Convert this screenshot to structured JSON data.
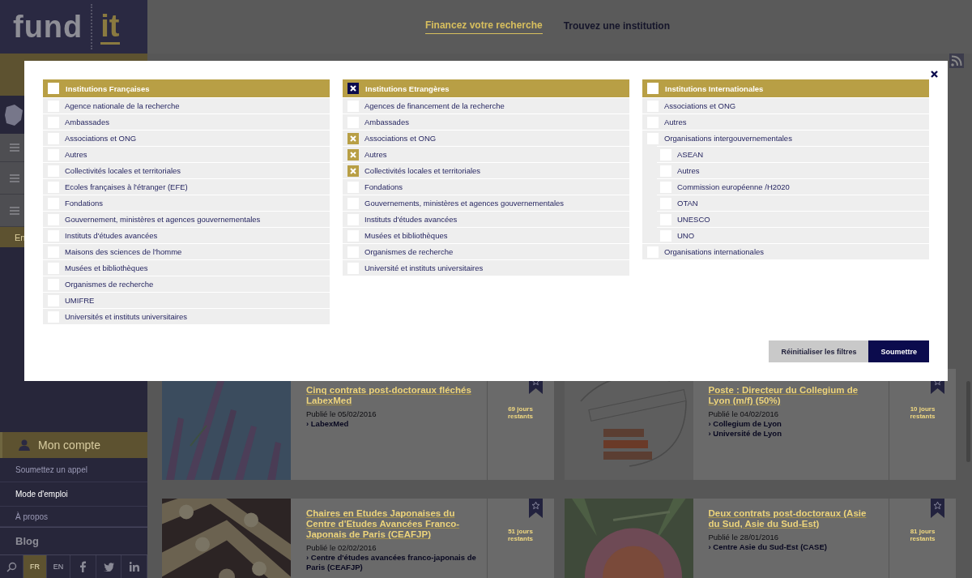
{
  "logo": {
    "word": "fund",
    "accent": "it"
  },
  "nav": [
    {
      "label": "Financez votre recherche",
      "selected": true
    },
    {
      "label": "Trouvez une institution",
      "selected": false
    }
  ],
  "sidebar": {
    "band_label": "En",
    "account": "Mon compte",
    "links": [
      {
        "label": "Soumettez un appel",
        "active": false
      },
      {
        "label": "Mode d'emploi",
        "active": true
      },
      {
        "label": "À propos",
        "active": false
      }
    ],
    "blog": "Blog",
    "languages": [
      {
        "label": "FR",
        "selected": true
      },
      {
        "label": "EN",
        "selected": false
      }
    ]
  },
  "cards": [
    {
      "kind": "lavender",
      "title": "Cinq contrats post-doctoraux fléchés LabexMed",
      "published": "Publié le 05/02/2016",
      "institutions": [
        "› LabexMed"
      ],
      "remaining": "69 jours restants"
    },
    {
      "kind": "logo",
      "title": "Poste : Directeur du Collegium de Lyon (m/f) (50%)",
      "published": "Publié le 04/02/2016",
      "institutions": [
        "› Collegium de Lyon",
        "› Université de Lyon"
      ],
      "remaining": "10 jours restants"
    },
    {
      "kind": "lanterns",
      "title": "Chaires en Etudes Japonaises du Centre d'Etudes Avancées Franco-Japonais de Paris (CEAFJP)",
      "published": "Publié le 02/02/2016",
      "institutions": [
        "› Centre d'études avancées franco-japonais de Paris (CEAFJP)"
      ],
      "remaining": "51 jours restants"
    },
    {
      "kind": "fan",
      "title": "Deux contrats post-doctoraux (Asie du Sud, Asie du Sud-Est)",
      "published": "Publié le 28/01/2016",
      "institutions": [
        "› Centre Asie du Sud-Est (CASE)"
      ],
      "remaining": "81 jours restants"
    }
  ],
  "modal": {
    "columns": [
      {
        "title": "Institutions Françaises",
        "checked": false,
        "items": [
          {
            "label": "Agence nationale de la recherche",
            "checked": false
          },
          {
            "label": "Ambassades",
            "checked": false
          },
          {
            "label": "Associations et ONG",
            "checked": false
          },
          {
            "label": "Autres",
            "checked": false
          },
          {
            "label": "Collectivités locales et territoriales",
            "checked": false
          },
          {
            "label": "Ecoles françaises à l'étranger (EFE)",
            "checked": false
          },
          {
            "label": "Fondations",
            "checked": false
          },
          {
            "label": "Gouvernement, ministères et agences gouvernementales",
            "checked": false
          },
          {
            "label": "Instituts d'études avancées",
            "checked": false
          },
          {
            "label": "Maisons des sciences de l'homme",
            "checked": false
          },
          {
            "label": "Musées et bibliothèques",
            "checked": false
          },
          {
            "label": "Organismes de recherche",
            "checked": false
          },
          {
            "label": "UMIFRE",
            "checked": false
          },
          {
            "label": "Universités et instituts universitaires",
            "checked": false
          }
        ]
      },
      {
        "title": "Institutions Etrangères",
        "checked": true,
        "items": [
          {
            "label": "Agences de financement de la recherche",
            "checked": false
          },
          {
            "label": "Ambassades",
            "checked": false
          },
          {
            "label": "Associations et ONG",
            "checked": true
          },
          {
            "label": "Autres",
            "checked": true
          },
          {
            "label": "Collectivités locales et territoriales",
            "checked": true
          },
          {
            "label": "Fondations",
            "checked": false
          },
          {
            "label": "Gouvernements, ministères et agences gouvernementales",
            "checked": false
          },
          {
            "label": "Instituts d'études avancées",
            "checked": false
          },
          {
            "label": "Musées et bibliothèques",
            "checked": false
          },
          {
            "label": "Organismes de recherche",
            "checked": false
          },
          {
            "label": "Université et instituts universitaires",
            "checked": false
          }
        ]
      },
      {
        "title": "Institutions Internationales",
        "checked": false,
        "items": [
          {
            "label": "Associations et ONG",
            "checked": false
          },
          {
            "label": "Autres",
            "checked": false
          },
          {
            "label": "Organisations intergouvernementales",
            "checked": false,
            "children": [
              {
                "label": "ASEAN",
                "checked": false
              },
              {
                "label": "Autres",
                "checked": false
              },
              {
                "label": "Commission européenne /H2020",
                "checked": false
              },
              {
                "label": "OTAN",
                "checked": false
              },
              {
                "label": "UNESCO",
                "checked": false
              },
              {
                "label": "UNO",
                "checked": false
              }
            ]
          },
          {
            "label": "Organisations internationales",
            "checked": false
          }
        ]
      }
    ],
    "buttons": [
      {
        "label": "Réinitialiser les filtres",
        "kind": "secondary"
      },
      {
        "label": "Soumettre",
        "kind": "primary"
      }
    ]
  }
}
